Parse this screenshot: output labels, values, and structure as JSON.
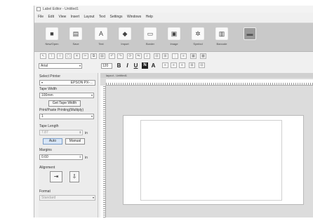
{
  "window": {
    "title": "Label Editor - Untitled1"
  },
  "menu": [
    "File",
    "Edit",
    "View",
    "Insert",
    "Layout",
    "Text",
    "Settings",
    "Windows",
    "Help"
  ],
  "ribbon": [
    {
      "label": "New/Open",
      "icon": "folder-icon"
    },
    {
      "label": "Save",
      "icon": "save-icon"
    },
    {
      "label": "Text",
      "icon": "text-icon"
    },
    {
      "label": "Import",
      "icon": "import-icon"
    },
    {
      "label": "Border",
      "icon": "border-icon"
    },
    {
      "label": "Image",
      "icon": "image-icon"
    },
    {
      "label": "Symbol",
      "icon": "symbol-icon"
    },
    {
      "label": "Barcode",
      "icon": "barcode-icon"
    },
    {
      "label": "",
      "icon": "printer-icon"
    }
  ],
  "format": {
    "font": "Arial",
    "size": "120",
    "bold": "B",
    "italic": "I",
    "underline": "U",
    "color": "A"
  },
  "sidebar": {
    "printer_label": "Select Printer",
    "printer_value": "EPSON PX-…",
    "tape_width_label": "Tape Width",
    "tape_width_value": "100mm",
    "get_tape_width": "Get Tape Width",
    "print_paste_label": "Print/Paste Printing(Multiply)",
    "print_paste_value": "1",
    "tape_length_label": "Tape Length",
    "tape_length_value": "7.87",
    "tape_length_unit": "in",
    "auto": "Auto",
    "manual": "Manual",
    "margins_label": "Margins",
    "margins_value": "0.60",
    "margins_unit": "in",
    "alignment_label": "Alignment",
    "format_label": "Format",
    "format_value": "Standard"
  },
  "document": {
    "tab_title": "layout - Untitled1"
  }
}
